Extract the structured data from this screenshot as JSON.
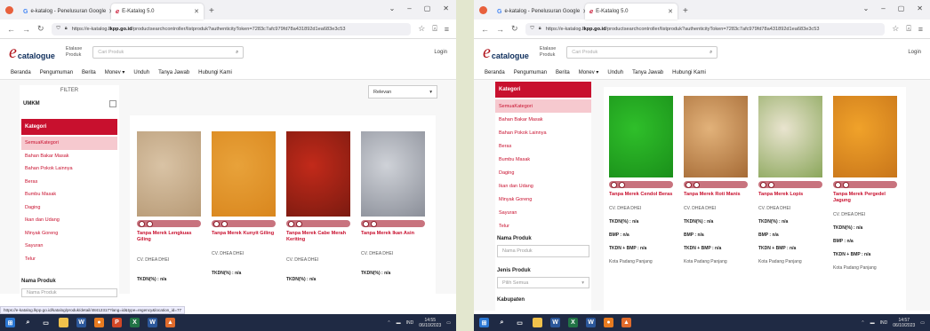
{
  "browser": {
    "tab1_title": "e-katalog - Penelusuran Google",
    "tab2_title": "E-Katalog 5.0",
    "url_prefix": "https://e-katalog.",
    "url_domain": "lkpp.go.id",
    "url_left_rest": "/productsearchcontroller/listproduk?authenticityToken=7283c7afc979fd78a431892d1ea683e3c53",
    "url_right_rest": "/productsearchcontroller/listproduk?authenticityToken=7283c7afc979fd78a431892d1ea683e3c53"
  },
  "site": {
    "logo_letter": "e",
    "logo_word": "catalogue",
    "etalase_line1": "Etalase",
    "etalase_line2": "Produk",
    "search_placeholder": "Cari Produk",
    "login": "Login",
    "menu": [
      "Beranda",
      "Pengumuman",
      "Berita",
      "Monev ▾",
      "Unduh",
      "Tanya Jawab",
      "Hubungi Kami"
    ]
  },
  "left": {
    "filter_title": "FILTER",
    "umkm": "UMKM",
    "sort_label": "Relevan",
    "kategori": "Kategori",
    "categories": [
      "SemuaKategori",
      "Bahan Bakar Masak",
      "Bahan Pokok Lainnya",
      "Beras",
      "Bumbu Masak",
      "Daging",
      "Ikan dan Udang",
      "Minyak Goreng",
      "Sayuran",
      "Telur"
    ],
    "nama_produk": "Nama Produk",
    "nama_produk_placeholder": "Nama Produk",
    "status_url": "https://e-katalog.lkpp.go.id/katalog/produk/detail/48412317?lang=id&type=regency&location_id=77",
    "products": [
      {
        "name": "Tanpa Merek Lengkuas Giling",
        "seller": "CV. DHEA DHEI",
        "tkdn": "TKDN(%) : n/a",
        "color1": "#d9c3a5",
        "color2": "#b79a76"
      },
      {
        "name": "Tanpa Merek Kunyit Giling",
        "seller": "CV. DHEA DHEI",
        "tkdn": "TKDN(%) : n/a",
        "color1": "#e8a23a",
        "color2": "#d9861d"
      },
      {
        "name": "Tanpa Merek Cabe Merah Keriting",
        "seller": "CV. DHEA DHEI",
        "tkdn": "TKDN(%) : n/a",
        "color1": "#c22a1a",
        "color2": "#7a1a10"
      },
      {
        "name": "Tanpa Merek Ikan Asin",
        "seller": "CV. DHEA DHEI",
        "tkdn": "TKDN(%) : n/a",
        "color1": "#cfd2d8",
        "color2": "#8a8e98"
      }
    ],
    "time": "14:55",
    "date": "06/10/2023"
  },
  "right": {
    "kategori": "Kategori",
    "categories": [
      "SemuaKategori",
      "Bahan Bakar Masak",
      "Bahan Pokok Lainnya",
      "Beras",
      "Bumbu Masak",
      "Daging",
      "Ikan dan Udang",
      "Minyak Goreng",
      "Sayuran",
      "Telur"
    ],
    "nama_produk": "Nama Produk",
    "nama_produk_placeholder": "Nama Produk",
    "jenis_produk": "Jenis Produk",
    "jenis_value": "Pilih Semua",
    "kabupaten": "Kabupaten",
    "products": [
      {
        "name": "Tanpa Merek Cendol Beras",
        "seller": "CV. DHEA DHEI",
        "tkdn": "TKDN(%) : n/a",
        "bmp": "BMP : n/a",
        "tkdn_bmp": "TKDN + BMP : n/a",
        "city": "Kota Padang Panjang",
        "color1": "#2fbf2a",
        "color2": "#1a8f1a"
      },
      {
        "name": "Tanpa Merek Roti Manis",
        "seller": "CV. DHEA DHEI",
        "tkdn": "TKDN(%) : n/a",
        "bmp": "BMP : n/a",
        "tkdn_bmp": "TKDN + BMP : n/a",
        "city": "Kota Padang Panjang",
        "color1": "#e2b27a",
        "color2": "#a56a35"
      },
      {
        "name": "Tanpa Merek Lopis",
        "seller": "CV. DHEA DHEI",
        "tkdn": "TKDN(%) : n/a",
        "bmp": "BMP : n/a",
        "tkdn_bmp": "TKDN + BMP : n/a",
        "city": "Kota Padang Panjang",
        "color1": "#e9e4cf",
        "color2": "#8aa65a"
      },
      {
        "name": "Tanpa Merek Pergedel Jagung",
        "seller": "CV. DHEA DHEI",
        "tkdn": "TKDN(%) : n/a",
        "bmp": "BMP : n/a",
        "tkdn_bmp": "TKDN + BMP : n/a",
        "city": "Kota Padang Panjang",
        "color1": "#f0a22a",
        "color2": "#c8751a"
      }
    ],
    "time": "14:57",
    "date": "06/10/2023"
  },
  "taskbar_lang": "IND"
}
